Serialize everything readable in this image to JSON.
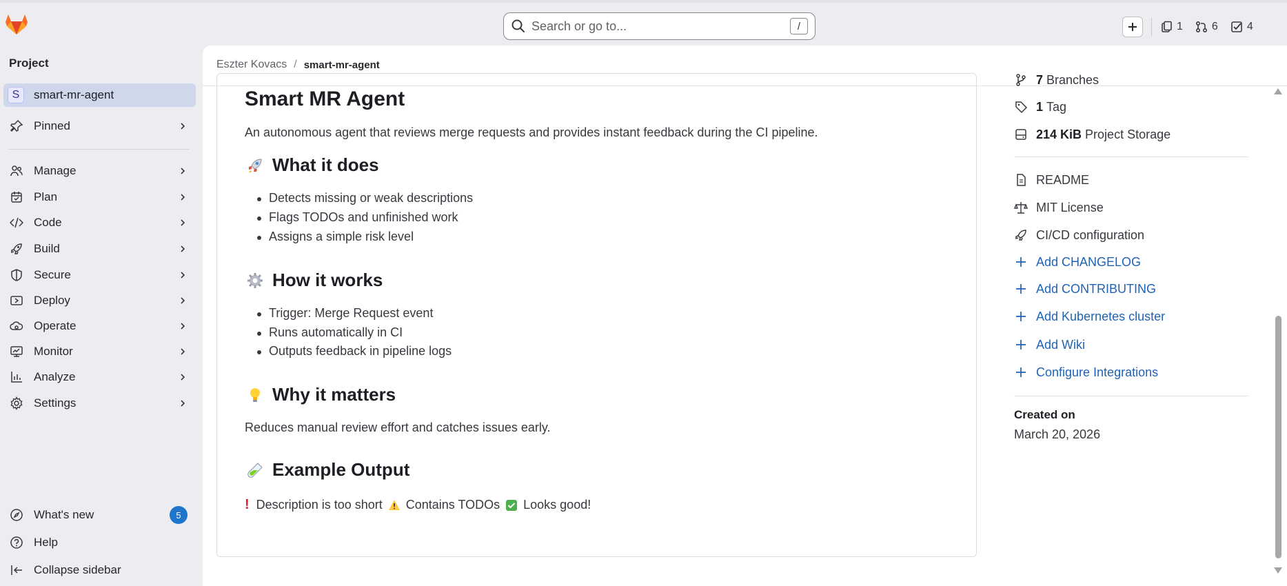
{
  "search": {
    "placeholder": "Search or go to...",
    "shortcut": "/"
  },
  "top_counts": {
    "issues": "1",
    "merge_requests": "6",
    "todos": "4"
  },
  "sidebar": {
    "title": "Project",
    "project": {
      "avatar": "S",
      "name": "smart-mr-agent"
    },
    "pinned": "Pinned",
    "items": [
      {
        "label": "Manage",
        "icon": "users-icon"
      },
      {
        "label": "Plan",
        "icon": "calendar-icon"
      },
      {
        "label": "Code",
        "icon": "code-icon"
      },
      {
        "label": "Build",
        "icon": "rocket-icon"
      },
      {
        "label": "Secure",
        "icon": "shield-icon"
      },
      {
        "label": "Deploy",
        "icon": "deploy-icon"
      },
      {
        "label": "Operate",
        "icon": "cloud-icon"
      },
      {
        "label": "Monitor",
        "icon": "monitor-icon"
      },
      {
        "label": "Analyze",
        "icon": "chart-icon"
      },
      {
        "label": "Settings",
        "icon": "gear-icon"
      }
    ],
    "whats_new": "What's new",
    "whats_new_count": "5",
    "help": "Help",
    "collapse": "Collapse sidebar"
  },
  "breadcrumb": {
    "owner": "Eszter Kovacs",
    "project": "smart-mr-agent"
  },
  "readme": {
    "title": "Smart MR Agent",
    "intro": "An autonomous agent that reviews merge requests and provides instant feedback during the CI pipeline.",
    "what_heading": "What it does",
    "what_items": [
      "Detects missing or weak descriptions",
      "Flags TODOs and unfinished work",
      "Assigns a simple risk level"
    ],
    "how_heading": "How it works",
    "how_items": [
      "Trigger: Merge Request event",
      "Runs automatically in CI",
      "Outputs feedback in pipeline logs"
    ],
    "why_heading": "Why it matters",
    "why_text": "Reduces manual review effort and catches issues early.",
    "example_heading": "Example Output",
    "example_part1": "Description is too short",
    "example_part2": "Contains TODOs",
    "example_part3": "Looks good!"
  },
  "project_info": {
    "branches_count": "7",
    "branches_label": "Branches",
    "tags_count": "1",
    "tags_label": "Tag",
    "storage_size": "214 KiB",
    "storage_label": "Project Storage",
    "readme": "README",
    "license": "MIT License",
    "cicd": "CI/CD configuration",
    "add_changelog": "Add CHANGELOG",
    "add_contributing": "Add CONTRIBUTING",
    "add_k8s": "Add Kubernetes cluster",
    "add_wiki": "Add Wiki",
    "configure_integrations": "Configure Integrations",
    "created_label": "Created on",
    "created_date": "March 20, 2026"
  },
  "colors": {
    "accent": "#1f75cb",
    "link": "#1f63b5",
    "selected": "#cfd8ea"
  }
}
